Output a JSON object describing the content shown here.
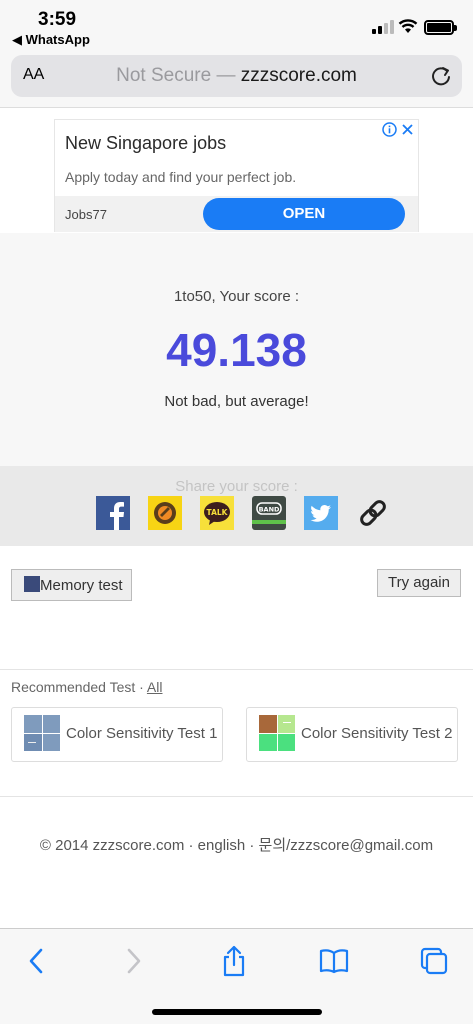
{
  "status_bar": {
    "time": "3:59",
    "back_app": "◀ WhatsApp"
  },
  "address_bar": {
    "text_size": "AA",
    "security": "Not Secure —",
    "domain": "zzzscore.com"
  },
  "ad": {
    "title": "New Singapore jobs",
    "description": "Apply today and find your perfect job.",
    "advertiser": "Jobs77",
    "cta": "OPEN"
  },
  "score": {
    "label": "1to50, Your score :",
    "value": "49.138",
    "remark": "Not bad, but average!"
  },
  "share": {
    "label": "Share your score :",
    "icons": [
      "facebook-icon",
      "kakaostory-icon",
      "kakaotalk-icon",
      "band-icon",
      "twitter-icon",
      "link-icon"
    ]
  },
  "actions": {
    "memory_test": "Memory test",
    "try_again": "Try again"
  },
  "recommended": {
    "title": "Recommended Test · ",
    "all": "All",
    "items": [
      {
        "name": "Color Sensitivity Test 1"
      },
      {
        "name": "Color Sensitivity Test 2"
      }
    ]
  },
  "footer": {
    "text": "© 2014 zzzscore.com · english · 문의/zzzscore@gmail.com"
  },
  "colors": {
    "score": "#4a4adb",
    "open_button": "#1a7cf5",
    "toolbar_icons": "#1a7cf5"
  }
}
